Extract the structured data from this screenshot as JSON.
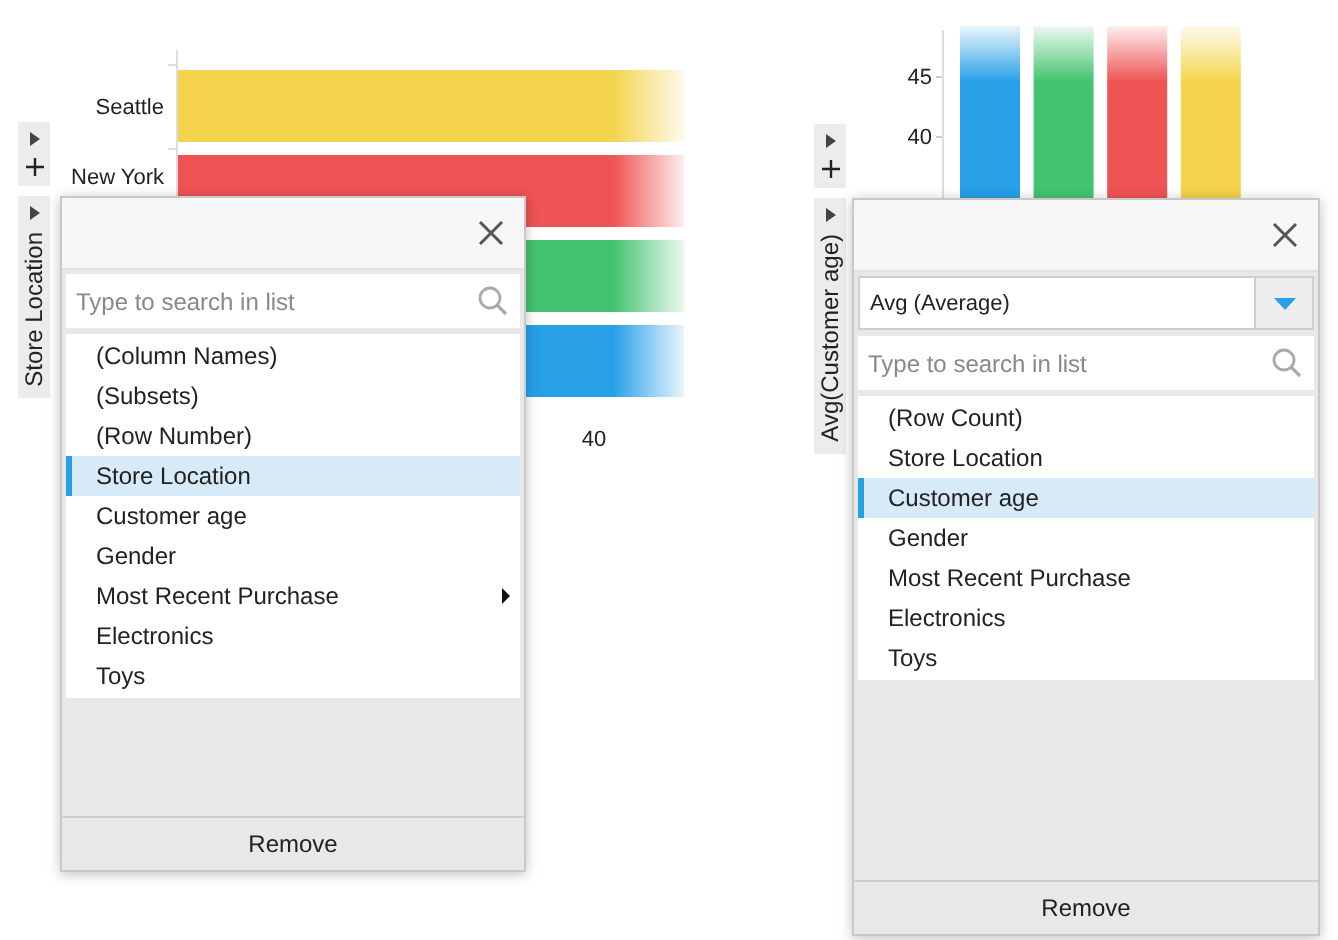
{
  "panels": [
    {
      "axis_label": "Store Location",
      "chart": {
        "kind": "horizontal",
        "categories": [
          {
            "label": "Seattle",
            "color": "#f4d44c"
          },
          {
            "label": "New York",
            "color": "#ef5354"
          },
          {
            "color": "#43c370"
          },
          {
            "color": "#27a0e8"
          }
        ],
        "ticks": [
          "40"
        ]
      },
      "popup": {
        "search": {
          "placeholder": "Type to search in list"
        },
        "items": [
          {
            "label": "(Column Names)",
            "selected": false,
            "has_submenu": false
          },
          {
            "label": "(Subsets)",
            "selected": false,
            "has_submenu": false
          },
          {
            "label": "(Row Number)",
            "selected": false,
            "has_submenu": false
          },
          {
            "label": "Store Location",
            "selected": true,
            "has_submenu": false
          },
          {
            "label": "Customer age",
            "selected": false,
            "has_submenu": false
          },
          {
            "label": "Gender",
            "selected": false,
            "has_submenu": false
          },
          {
            "label": "Most Recent Purchase",
            "selected": false,
            "has_submenu": true
          },
          {
            "label": "Electronics",
            "selected": false,
            "has_submenu": false
          },
          {
            "label": "Toys",
            "selected": false,
            "has_submenu": false
          }
        ],
        "button": "Remove"
      }
    },
    {
      "axis_label": "Avg(Customer age)",
      "chart": {
        "kind": "vertical",
        "categories": [
          {
            "color": "#27a0e8"
          },
          {
            "color": "#43c370"
          },
          {
            "color": "#ef5354"
          },
          {
            "color": "#f4d44c"
          }
        ],
        "ticks": [
          "45",
          "40"
        ]
      },
      "popup": {
        "aggregation": {
          "value": "Avg (Average)"
        },
        "search": {
          "placeholder": "Type to search in list"
        },
        "items": [
          {
            "label": "(Row Count)",
            "selected": false,
            "has_submenu": false
          },
          {
            "label": "Store Location",
            "selected": false,
            "has_submenu": false
          },
          {
            "label": "Customer age",
            "selected": true,
            "has_submenu": false
          },
          {
            "label": "Gender",
            "selected": false,
            "has_submenu": false
          },
          {
            "label": "Most Recent Purchase",
            "selected": false,
            "has_submenu": false
          },
          {
            "label": "Electronics",
            "selected": false,
            "has_submenu": false
          },
          {
            "label": "Toys",
            "selected": false,
            "has_submenu": false
          }
        ],
        "button": "Remove"
      }
    }
  ]
}
